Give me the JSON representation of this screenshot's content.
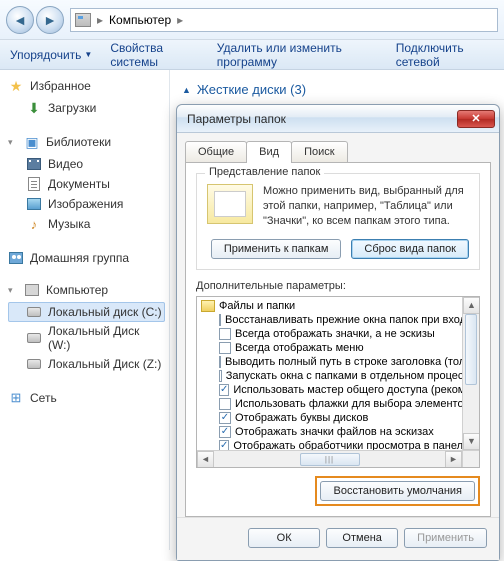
{
  "addressbar": {
    "root": "Компьютер",
    "sep1": "▸",
    "sep2": "▸"
  },
  "cmdbar": {
    "organize": "Упорядочить",
    "props": "Свойства системы",
    "uninstall": "Удалить или изменить программу",
    "netdrive": "Подключить сетевой"
  },
  "nav": {
    "favorites": "Избранное",
    "downloads": "Загрузки",
    "libraries": "Библиотеки",
    "video": "Видео",
    "documents": "Документы",
    "pictures": "Изображения",
    "music": "Музыка",
    "homegroup": "Домашняя группа",
    "computer": "Компьютер",
    "disk_c": "Локальный диск (C:)",
    "disk_w": "Локальный Диск (W:)",
    "disk_z": "Локальный Диск (Z:)",
    "network": "Сеть"
  },
  "content": {
    "hdds_header": "Жесткие диски (3)"
  },
  "dialog": {
    "title": "Параметры папок",
    "tabs": {
      "general": "Общие",
      "view": "Вид",
      "search": "Поиск"
    },
    "folderview": {
      "legend": "Представление папок",
      "text": "Можно применить вид, выбранный для этой папки, например, \"Таблица\" или \"Значки\", ко всем папкам этого типа.",
      "apply": "Применить к папкам",
      "reset": "Сброс вида папок"
    },
    "adv": {
      "label": "Дополнительные параметры:",
      "root": "Файлы и папки",
      "items": [
        {
          "checked": false,
          "text": "Восстанавливать прежние окна папок при входе в си"
        },
        {
          "checked": false,
          "text": "Всегда отображать значки, а не эскизы"
        },
        {
          "checked": false,
          "text": "Всегда отображать меню"
        },
        {
          "checked": false,
          "text": "Выводить полный путь в строке заголовка (только кл"
        },
        {
          "checked": false,
          "text": "Запускать окна с папками в отдельном процессе"
        },
        {
          "checked": true,
          "text": "Использовать мастер общего доступа (рекомендует"
        },
        {
          "checked": false,
          "text": "Использовать флажки для выбора элементов"
        },
        {
          "checked": true,
          "text": "Отображать буквы дисков"
        },
        {
          "checked": true,
          "text": "Отображать значки файлов на эскизах"
        },
        {
          "checked": true,
          "text": "Отображать обработчики просмотра в панели просм"
        }
      ]
    },
    "restore": "Восстановить умолчания",
    "ok": "ОК",
    "cancel": "Отмена",
    "apply": "Применить"
  }
}
